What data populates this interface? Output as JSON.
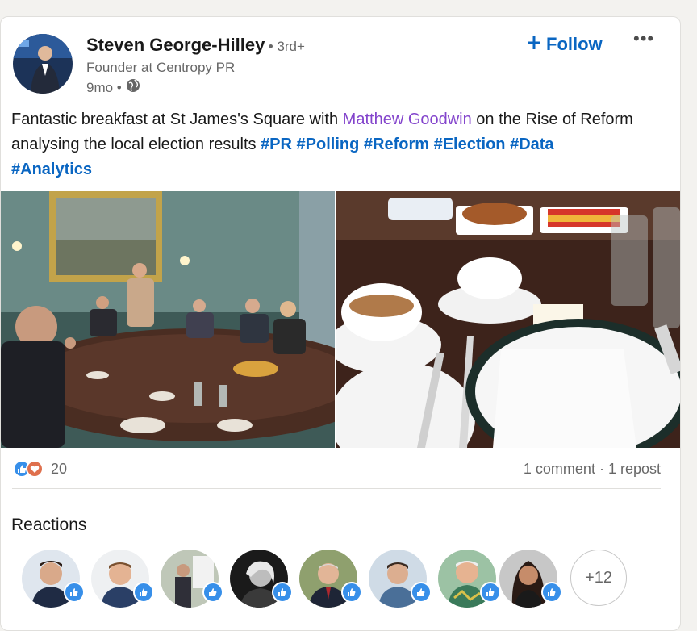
{
  "post": {
    "author": {
      "name": "Steven George-Hilley",
      "degree": "• 3rd+",
      "headline": "Founder at Centropy PR",
      "age": "9mo •",
      "visibility_icon": "globe-icon"
    },
    "follow_label": "Follow",
    "text_before_mention": "Fantastic breakfast at St James's Square with ",
    "mention": "Matthew Goodwin",
    "text_after_mention": " on the Rise of Reform analysing the local election results ",
    "hashtags": [
      "#PR",
      "#Polling",
      "#Reform",
      "#Election",
      "#Data",
      "#Analytics"
    ],
    "reaction_count": "20",
    "comments": "1 comment",
    "separator": " · ",
    "reposts": "1 repost"
  },
  "reactions": {
    "title": "Reactions",
    "more_label": "+12"
  },
  "colors": {
    "link_blue": "#0a66c2",
    "mention_purple": "#8344cc",
    "like_blue": "#378fe9",
    "love_red": "#df704d"
  }
}
